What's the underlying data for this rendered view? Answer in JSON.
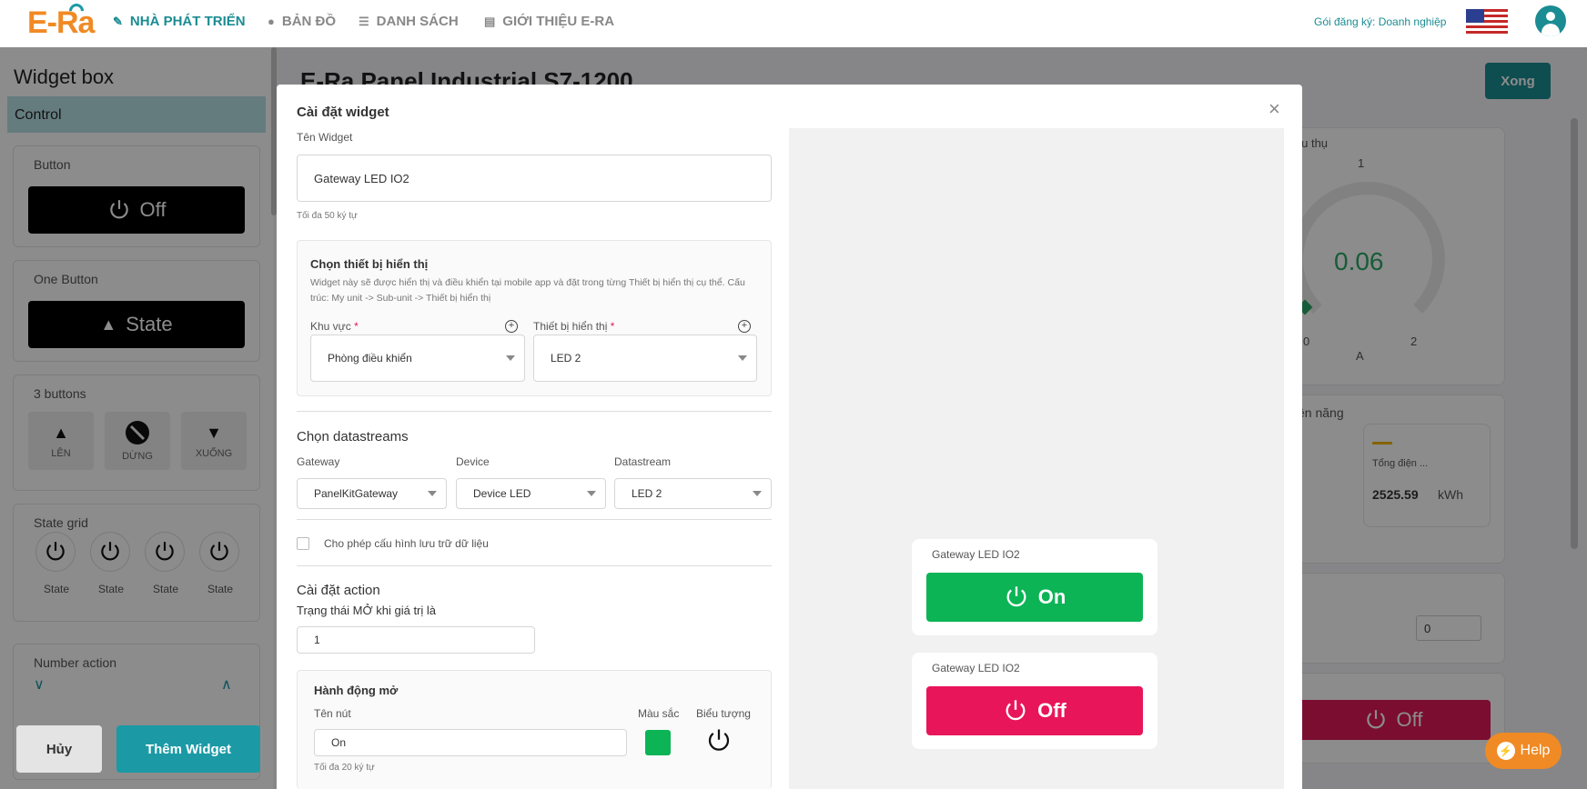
{
  "nav": {
    "logo": "E-Ra",
    "items": [
      {
        "label": "NHÀ PHÁT TRIỂN",
        "icon": "wrench-icon",
        "active": true
      },
      {
        "label": "BẢN ĐỒ",
        "icon": "map-pin-icon",
        "active": false
      },
      {
        "label": "DANH SÁCH",
        "icon": "list-icon",
        "active": false
      },
      {
        "label": "GIỚI THIỆU E-RA",
        "icon": "document-icon",
        "active": false
      }
    ],
    "plan": "Gói đăng ký: Doanh nghiệp",
    "language_flag": "us-flag-icon",
    "user_icon": "user-avatar-icon"
  },
  "widget_box": {
    "title": "Widget box",
    "tab": "Control",
    "button": {
      "label": "Button",
      "value": "Off"
    },
    "one_button": {
      "label": "One Button",
      "value": "State"
    },
    "three_buttons": {
      "label": "3 buttons",
      "items": [
        "LÊN",
        "DỪNG",
        "XUỐNG"
      ]
    },
    "state_grid": {
      "label": "State grid",
      "items": [
        "State",
        "State",
        "State",
        "State"
      ]
    },
    "number_action": {
      "label": "Number action"
    },
    "cancel": "Hủy",
    "add": "Thêm Widget"
  },
  "dashboard": {
    "title": "E-Ra Panel Industrial S7-1200",
    "done": "Xong",
    "consumption_label": "iêu thụ",
    "gauge_top": "1",
    "gauge_value": "0.06",
    "gauge_min": "0",
    "gauge_max": "2",
    "gauge_unit": "A",
    "energy_label": "ện năng",
    "total_label": "Tổng điện ...",
    "total_value": "2525.59",
    "total_unit": "kWh",
    "number_input": "0",
    "off_button": "Off",
    "help": "Help"
  },
  "modal": {
    "title": "Cài đặt widget",
    "widget_name_label": "Tên Widget",
    "widget_name_value": "Gateway LED IO2",
    "widget_name_hint": "Tối đa 50 ký tự",
    "device_section": {
      "title": "Chọn thiết bị hiển thị",
      "desc": "Widget này sẽ được hiển thị và điều khiển tại mobile app và đặt trong từng Thiết bị hiển thị cụ thể. Cấu trúc: My unit -> Sub-unit -> Thiết bị hiển thị",
      "area_label": "Khu vực",
      "area_value": "Phòng điều khiển",
      "display_label": "Thiết bị hiển thị",
      "display_value": "LED 2",
      "required_mark": "*"
    },
    "datastreams": {
      "title": "Chọn datastreams",
      "gateway_label": "Gateway",
      "gateway_value": "PanelKitGateway",
      "device_label": "Device",
      "device_value": "Device LED",
      "datastream_label": "Datastream",
      "datastream_value": "LED 2"
    },
    "storage_checkbox": "Cho phép cấu hình lưu trữ dữ liệu",
    "action": {
      "title": "Cài đặt action",
      "open_state_label": "Trạng thái MỞ khi giá trị là",
      "open_state_value": "1",
      "open_action_title": "Hành động mở",
      "button_name_label": "Tên nút",
      "button_name_value": "On",
      "button_name_hint": "Tối đa 20 ký tự",
      "color_label": "Màu sắc",
      "color_value": "#0cb456",
      "icon_label": "Biểu tượng",
      "icon": "power-icon"
    },
    "preview": [
      {
        "name": "Gateway LED IO2",
        "label": "On",
        "color": "#0cb456"
      },
      {
        "name": "Gateway LED IO2",
        "label": "Off",
        "color": "#e8155a"
      }
    ]
  }
}
